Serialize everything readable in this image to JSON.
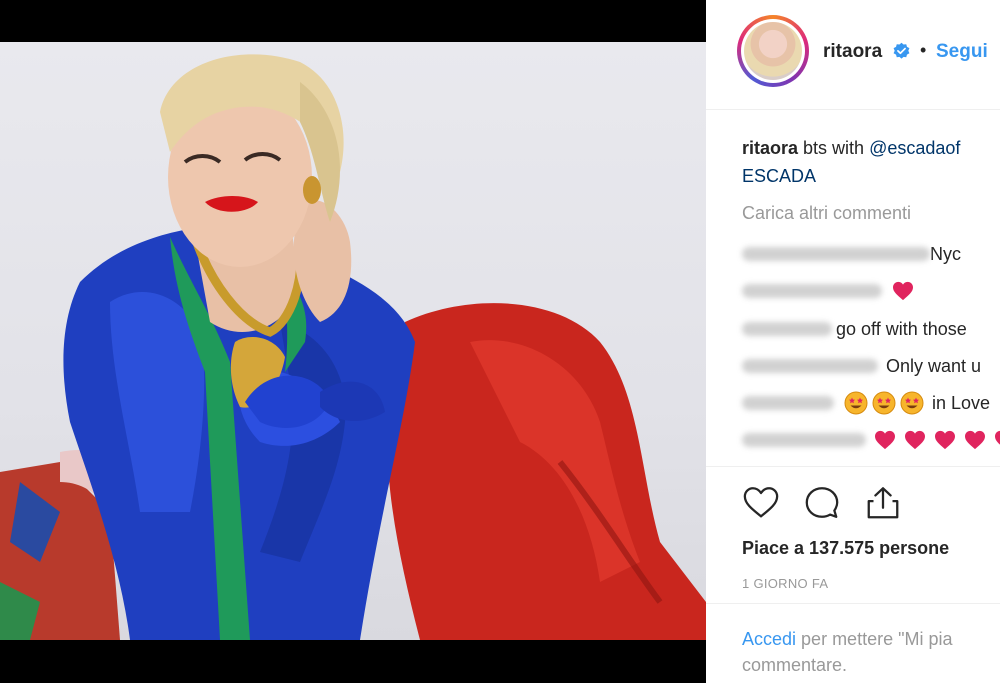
{
  "post": {
    "username": "ritaora",
    "separator": "•",
    "follow_label": "Segui",
    "caption": {
      "username": "ritaora",
      "text": "bts with",
      "mention": "@escadaof",
      "line2": "ESCADA"
    },
    "load_more_label": "Carica altri commenti",
    "comments": [
      {
        "text": "Nyc",
        "emoji": ""
      },
      {
        "text": "",
        "emoji": "heart"
      },
      {
        "text": "go off with those",
        "emoji": ""
      },
      {
        "text": "Only want u",
        "emoji": ""
      },
      {
        "text": "in Love",
        "emoji": "star-eyes"
      },
      {
        "text": "",
        "emoji": "hearts"
      }
    ],
    "likes_label": "Piace a 137.575 persone",
    "time_label": "1 GIORNO FA",
    "login": {
      "link_label": "Accedi",
      "rest_line1": "per mettere \"Mi pia",
      "line2": "commentare."
    }
  },
  "icons": {
    "verified": "verified-badge-icon",
    "like": "heart-outline-icon",
    "comment": "comment-bubble-icon",
    "share": "share-upload-icon"
  },
  "colors": {
    "accent": "#3897f0",
    "verified": "#3897f0",
    "heart_emoji": "#e0245e",
    "muted": "#999999",
    "text": "#262626"
  }
}
